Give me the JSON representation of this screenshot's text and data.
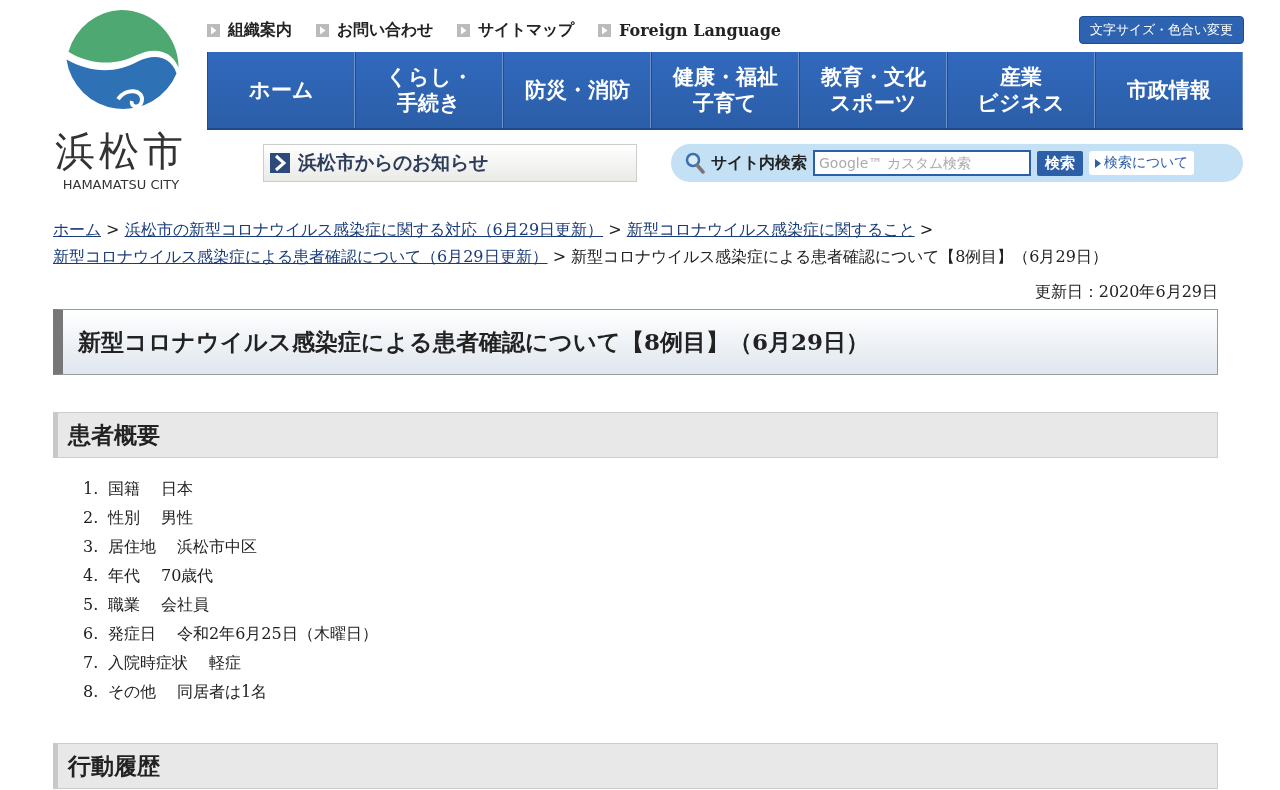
{
  "logo": {
    "name": "浜松市",
    "subtitle": "HAMAMATSU CITY"
  },
  "utility_links": [
    {
      "label": "組織案内"
    },
    {
      "label": "お問い合わせ"
    },
    {
      "label": "サイトマップ"
    },
    {
      "label": "Foreign Language"
    }
  ],
  "display_settings_button": "文字サイズ・色合い変更",
  "nav": [
    {
      "lines": [
        "ホーム"
      ]
    },
    {
      "lines": [
        "くらし・",
        "手続き"
      ]
    },
    {
      "lines": [
        "防災・消防"
      ]
    },
    {
      "lines": [
        "健康・福祉",
        "子育て"
      ]
    },
    {
      "lines": [
        "教育・文化",
        "スポーツ"
      ]
    },
    {
      "lines": [
        "産業",
        "ビジネス"
      ]
    },
    {
      "lines": [
        "市政情報"
      ]
    }
  ],
  "notice_link": "浜松市からのお知らせ",
  "search": {
    "label": "サイト内検索",
    "placeholder": "Google™ カスタム検索",
    "button": "検索",
    "help_link": "検索について"
  },
  "breadcrumb": {
    "separator": ">",
    "items": [
      {
        "text": "ホーム",
        "kind": "link"
      },
      {
        "text": "浜松市の新型コロナウイルス感染症に関する対応（6月29日更新）",
        "kind": "link"
      },
      {
        "text": "新型コロナウイルス感染症に関すること",
        "kind": "link"
      },
      {
        "text": "新型コロナウイルス感染症による患者確認について（6月29日更新）",
        "kind": "link"
      },
      {
        "text": "新型コロナウイルス感染症による患者確認について【8例目】（6月29日）",
        "kind": "current"
      }
    ]
  },
  "updated": "更新日：2020年6月29日",
  "page_title": "新型コロナウイルス感染症による患者確認について【8例目】（6月29日）",
  "sections": [
    {
      "heading": "患者概要",
      "items": [
        {
          "number": "1.",
          "label": "国籍",
          "value": "日本"
        },
        {
          "number": "2.",
          "label": "性別",
          "value": "男性"
        },
        {
          "number": "3.",
          "label": "居住地",
          "value": "浜松市中区"
        },
        {
          "number": "4.",
          "label": "年代",
          "value": "70歳代"
        },
        {
          "number": "5.",
          "label": "職業",
          "value": "会社員"
        },
        {
          "number": "6.",
          "label": "発症日",
          "value": "令和2年6月25日（木曜日）"
        },
        {
          "number": "7.",
          "label": "入院時症状",
          "value": "軽症"
        },
        {
          "number": "8.",
          "label": "その他",
          "value": "同居者は1名"
        }
      ]
    },
    {
      "heading": "行動履歴"
    }
  ]
}
